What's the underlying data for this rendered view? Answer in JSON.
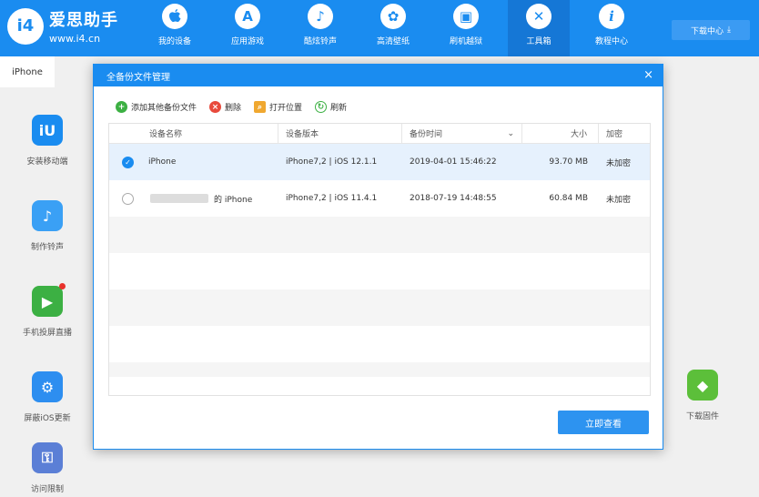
{
  "app": {
    "logo_badge": "i4",
    "title": "爱思助手",
    "url": "www.i4.cn"
  },
  "nav": [
    {
      "label": "我的设备",
      "icon": "apple-icon",
      "glyph": ""
    },
    {
      "label": "应用游戏",
      "icon": "app-store-icon",
      "glyph": "A"
    },
    {
      "label": "酷炫铃声",
      "icon": "bell-icon",
      "glyph": "♪"
    },
    {
      "label": "高清壁纸",
      "icon": "wallpaper-icon",
      "glyph": "✿"
    },
    {
      "label": "刷机越狱",
      "icon": "box-icon",
      "glyph": "▣"
    },
    {
      "label": "工具箱",
      "icon": "tools-icon",
      "glyph": "✕"
    },
    {
      "label": "教程中心",
      "icon": "info-icon",
      "glyph": "i"
    }
  ],
  "download_center": "下载中心",
  "device_tab": "iPhone",
  "left_tools": [
    {
      "label": "安装移动端",
      "icon": "i4-app-icon",
      "color": "#1a8cf0",
      "glyph": "iU"
    },
    {
      "label": "制作铃声",
      "icon": "bell-plus-icon",
      "color": "#3aa0f5",
      "glyph": "♪"
    },
    {
      "label": "手机投屏直播",
      "icon": "screen-cast-icon",
      "color": "#3cb043",
      "glyph": "▶"
    },
    {
      "label": "屏蔽iOS更新",
      "icon": "gear-icon",
      "color": "#2d8ef0",
      "glyph": "⚙"
    },
    {
      "label": "访问限制",
      "icon": "lock-icon",
      "color": "#5b7fd6",
      "glyph": "⚿"
    }
  ],
  "right_tool": {
    "label": "下载固件",
    "icon": "cube-icon",
    "color": "#5cbf3a",
    "glyph": "◆"
  },
  "dialog": {
    "title": "全备份文件管理",
    "close": "×",
    "toolbar": [
      {
        "label": "添加其他备份文件",
        "icon": "add-icon",
        "color": "#3cb043",
        "glyph": "+"
      },
      {
        "label": "删除",
        "icon": "delete-icon",
        "color": "#e84a3c",
        "glyph": "×"
      },
      {
        "label": "打开位置",
        "icon": "folder-search-icon",
        "color": "#f0a830",
        "glyph": "⌕"
      },
      {
        "label": "刷新",
        "icon": "refresh-icon",
        "color": "#3cb043",
        "glyph": "↻"
      }
    ],
    "columns": {
      "name": "设备名称",
      "version": "设备版本",
      "time": "备份时间",
      "size": "大小",
      "enc": "加密"
    },
    "sort_indicator": "⌄",
    "rows": [
      {
        "name": "iPhone",
        "version": "iPhone7,2 | iOS 12.1.1",
        "time": "2019-04-01 15:46:22",
        "size": "93.70 MB",
        "enc": "未加密",
        "selected": true
      },
      {
        "name": "的 iPhone",
        "version": "iPhone7,2 | iOS 11.4.1",
        "time": "2018-07-19 14:48:55",
        "size": "60.84 MB",
        "enc": "未加密",
        "selected": false
      }
    ],
    "check_glyph": "✓",
    "view_button": "立即查看"
  }
}
